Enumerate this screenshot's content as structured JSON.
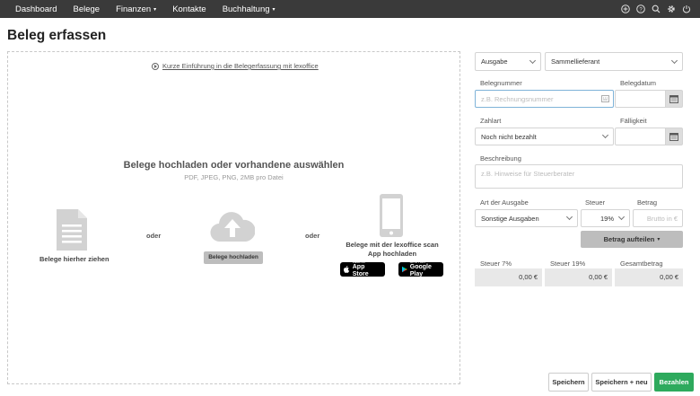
{
  "nav": {
    "items": [
      {
        "label": "Dashboard",
        "dropdown": false
      },
      {
        "label": "Belege",
        "dropdown": false
      },
      {
        "label": "Finanzen",
        "dropdown": true
      },
      {
        "label": "Kontakte",
        "dropdown": false
      },
      {
        "label": "Buchhaltung",
        "dropdown": true
      }
    ],
    "icons": [
      "plus-circle-icon",
      "help-icon",
      "search-icon",
      "gear-icon",
      "power-icon"
    ]
  },
  "page": {
    "title": "Beleg erfassen"
  },
  "upload": {
    "intro_link": "Kurze Einführung in die Belegerfassung mit lexoffice",
    "heading": "Belege hochladen oder vorhandene auswählen",
    "subheading": "PDF, JPEG, PNG, 2MB pro Datei",
    "drag_label": "Belege hierher ziehen",
    "or_1": "oder",
    "or_2": "oder",
    "upload_button": "Belege hochladen",
    "app_label_1": "Belege mit der lexoffice scan",
    "app_label_2": "App hochladen",
    "appstore_small": "Laden im",
    "appstore_big": "App Store",
    "googleplay_small": "JETZT BEI",
    "googleplay_big": "Google Play"
  },
  "form": {
    "type_value": "Ausgabe",
    "supplier_value": "Sammellieferant",
    "belegnummer_label": "Belegnummer",
    "belegnummer_placeholder": "z.B. Rechnungsnummer",
    "belegdatum_label": "Belegdatum",
    "zahlart_label": "Zahlart",
    "zahlart_value": "Noch nicht bezahlt",
    "faelligkeit_label": "Fälligkeit",
    "beschreibung_label": "Beschreibung",
    "beschreibung_placeholder": "z.B. Hinweise für Steuerberater",
    "art_label": "Art der Ausgabe",
    "art_value": "Sonstige Ausgaben",
    "steuer_label": "Steuer",
    "steuer_value": "19%",
    "betrag_label": "Betrag",
    "betrag_placeholder": "Brutto in €",
    "split_button": "Betrag aufteilen",
    "sum": {
      "steuer7_label": "Steuer 7%",
      "steuer7_value": "0,00 €",
      "steuer19_label": "Steuer 19%",
      "steuer19_value": "0,00 €",
      "gesamt_label": "Gesamtbetrag",
      "gesamt_value": "0,00 €"
    }
  },
  "footer": {
    "save": "Speichern",
    "save_new": "Speichern + neu",
    "pay": "Bezahlen"
  },
  "colors": {
    "nav_bg": "#3a3a3a",
    "primary": "#2eaa5d",
    "focus_border": "#7fb3d8"
  }
}
